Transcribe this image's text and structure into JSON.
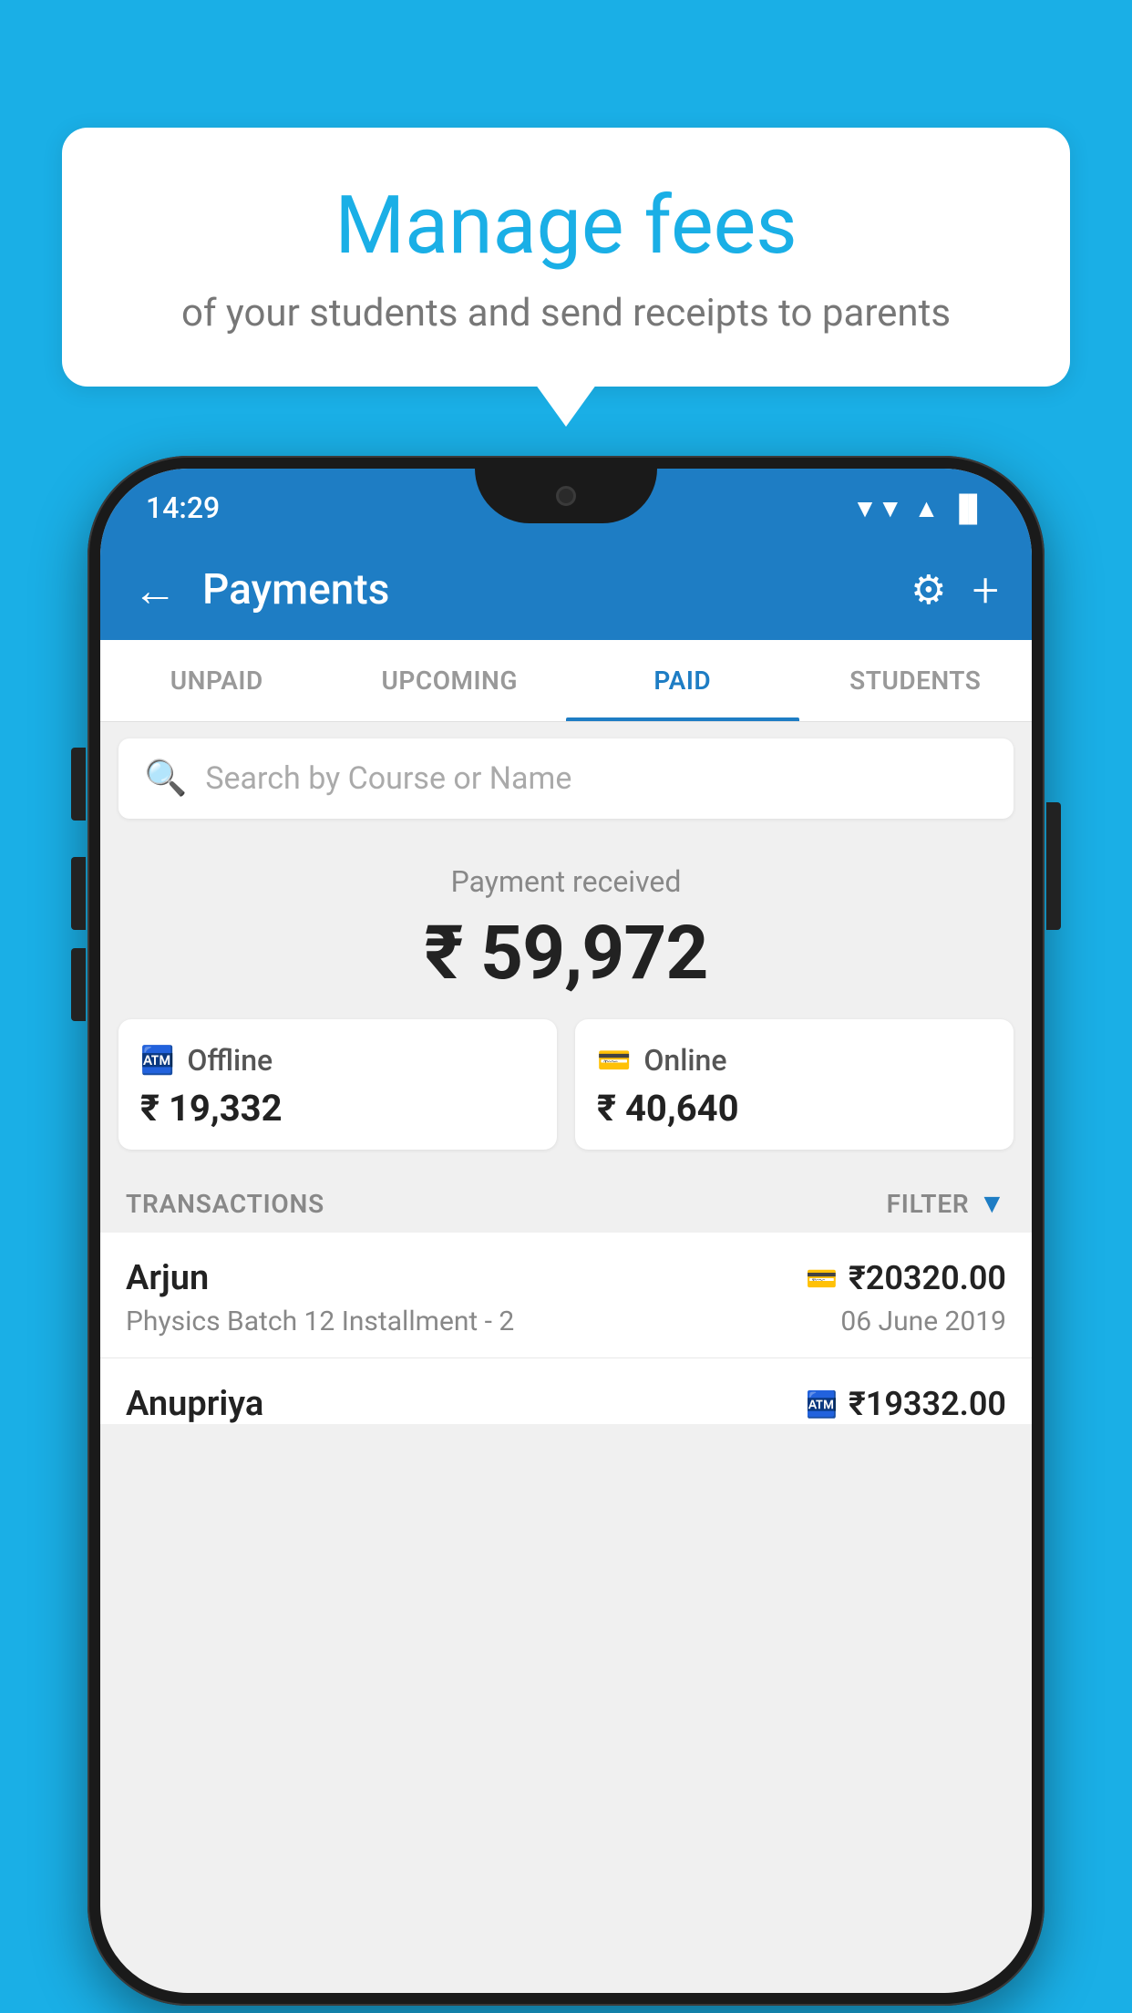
{
  "background_color": "#1AAFE6",
  "bubble": {
    "title": "Manage fees",
    "subtitle": "of your students and send receipts to parents"
  },
  "status_bar": {
    "time": "14:29",
    "wifi_icon": "▼",
    "signal_icon": "▲",
    "battery_icon": "▐"
  },
  "header": {
    "title": "Payments",
    "back_label": "←",
    "plus_label": "+",
    "gear_label": "⚙"
  },
  "tabs": [
    {
      "id": "unpaid",
      "label": "UNPAID",
      "active": false
    },
    {
      "id": "upcoming",
      "label": "UPCOMING",
      "active": false
    },
    {
      "id": "paid",
      "label": "PAID",
      "active": true
    },
    {
      "id": "students",
      "label": "STUDENTS",
      "active": false
    }
  ],
  "search": {
    "placeholder": "Search by Course or Name"
  },
  "payment_received": {
    "label": "Payment received",
    "amount": "₹ 59,972"
  },
  "payment_cards": [
    {
      "id": "offline",
      "icon": "₹",
      "type": "Offline",
      "amount": "₹ 19,332"
    },
    {
      "id": "online",
      "icon": "▬",
      "type": "Online",
      "amount": "₹ 40,640"
    }
  ],
  "transactions_header": {
    "label": "TRANSACTIONS",
    "filter_label": "FILTER"
  },
  "transactions": [
    {
      "name": "Arjun",
      "icon": "▬",
      "amount": "₹20320.00",
      "course": "Physics Batch 12 Installment - 2",
      "date": "06 June 2019"
    },
    {
      "name": "Anupriya",
      "icon": "₹",
      "amount": "₹19332.00",
      "course": "",
      "date": ""
    }
  ],
  "icons": {
    "search": "🔍",
    "back": "←",
    "gear": "⚙",
    "plus": "+",
    "filter_triangle": "▼",
    "card_online": "💳",
    "card_offline": "🏧"
  }
}
